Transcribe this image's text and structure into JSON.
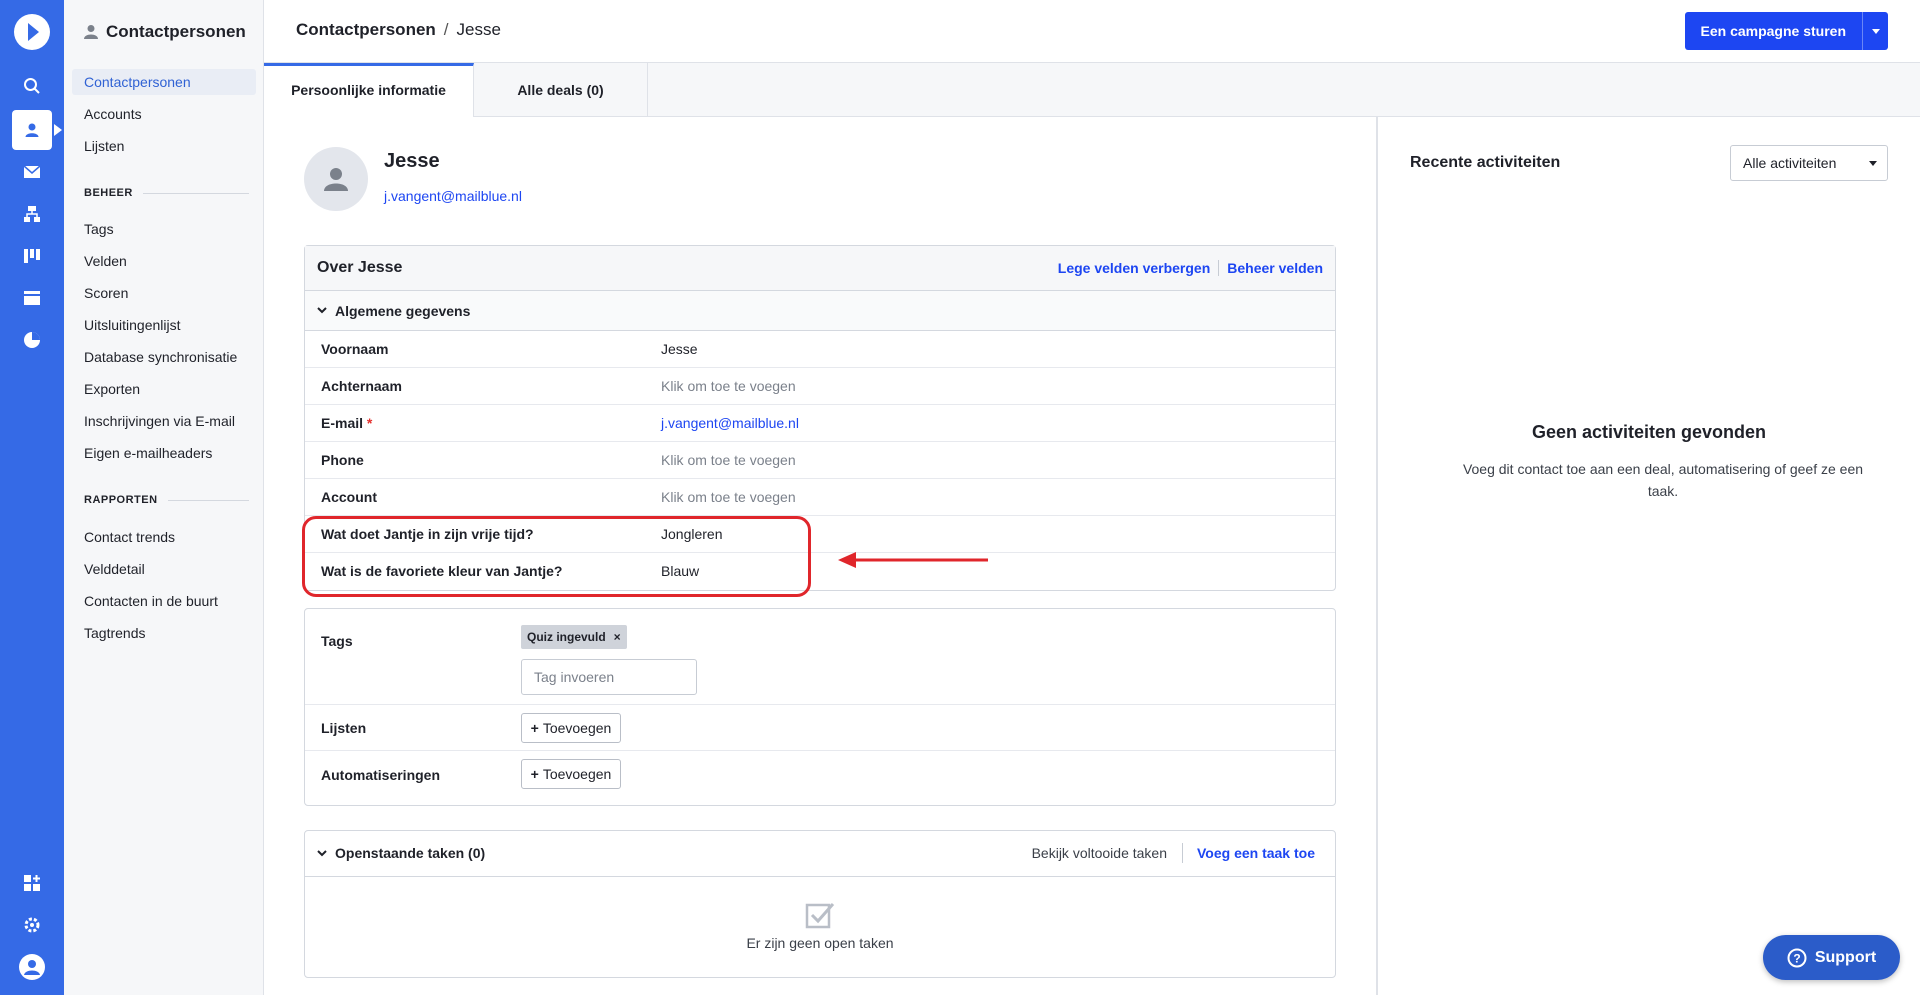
{
  "sidebar": {
    "title": "Contactpersonen",
    "items": [
      "Contactpersonen",
      "Accounts",
      "Lijsten"
    ],
    "beheer_label": "BEHEER",
    "beheer_items": [
      "Tags",
      "Velden",
      "Scoren",
      "Uitsluitingenlijst",
      "Database synchronisatie",
      "Exporten",
      "Inschrijvingen via E-mail",
      "Eigen e-mailheaders"
    ],
    "rapporten_label": "RAPPORTEN",
    "rapporten_items": [
      "Contact trends",
      "Velddetail",
      "Contacten in de buurt",
      "Tagtrends"
    ]
  },
  "header": {
    "breadcrumb_root": "Contactpersonen",
    "breadcrumb_sep": "/",
    "breadcrumb_current": "Jesse",
    "campaign_button": "Een campagne sturen"
  },
  "tabs": [
    "Persoonlijke informatie",
    "Alle deals (0)"
  ],
  "contact": {
    "name": "Jesse",
    "email": "j.vangent@mailblue.nl"
  },
  "about": {
    "title": "Over Jesse",
    "hide_empty": "Lege velden verbergen",
    "manage_fields": "Beheer velden",
    "section": "Algemene gegevens",
    "fields": [
      {
        "label": "Voornaam",
        "value": "Jesse"
      },
      {
        "label": "Achternaam",
        "value": "Klik om toe te voegen"
      },
      {
        "label": "E-mail",
        "value": "j.vangent@mailblue.nl",
        "required_mark": "*"
      },
      {
        "label": "Phone",
        "value": "Klik om toe te voegen"
      },
      {
        "label": "Account",
        "value": "Klik om toe te voegen"
      },
      {
        "label": "Wat doet Jantje in zijn vrije tijd?",
        "value": "Jongleren"
      },
      {
        "label": "Wat is de favoriete kleur van Jantje?",
        "value": "Blauw"
      }
    ]
  },
  "tags_card": {
    "tags_label": "Tags",
    "tag": "Quiz ingevuld",
    "tag_remove": "×",
    "tag_placeholder": "Tag invoeren",
    "lists_label": "Lijsten",
    "automations_label": "Automatiseringen",
    "add_plus": "+",
    "add_label": "Toevoegen"
  },
  "tasks": {
    "title": "Openstaande taken (0)",
    "view_done": "Bekijk voltooide taken",
    "add_task": "Voeg een taak toe",
    "empty": "Er zijn geen open taken"
  },
  "activity": {
    "title": "Recente activiteiten",
    "filter": "Alle activiteiten",
    "empty_title": "Geen activiteiten gevonden",
    "empty_desc": "Voeg dit contact toe aan een deal, automatisering of geef ze een taak."
  },
  "support": {
    "label": "Support",
    "icon_char": "?"
  },
  "colors": {
    "accent": "#356ae6",
    "link": "#1d46f2",
    "highlight": "#e0262b"
  }
}
